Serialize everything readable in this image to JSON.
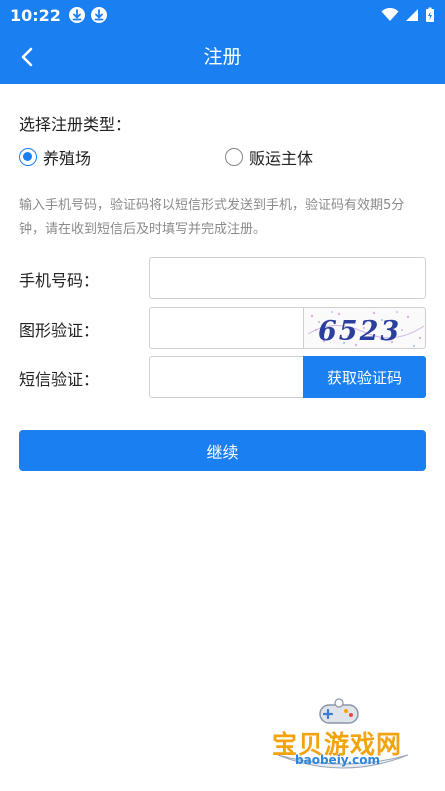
{
  "status_bar": {
    "time": "10:22",
    "icons": [
      "download-icon",
      "download-icon",
      "wifi-icon",
      "signal-icon",
      "battery-charging-icon"
    ]
  },
  "header": {
    "title": "注册",
    "back_icon": "chevron-left-icon",
    "color": "#1a7ff0"
  },
  "register_type": {
    "label": "选择注册类型：",
    "options": [
      {
        "label": "养殖场",
        "selected": true
      },
      {
        "label": "贩运主体",
        "selected": false
      }
    ]
  },
  "hint": "输入手机号码，验证码将以短信形式发送到手机，验证码有效期5分钟，请在收到短信后及时填写并完成注册。",
  "form": {
    "phone": {
      "label": "手机号码：",
      "value": "",
      "placeholder": ""
    },
    "captcha": {
      "label": "图形验证：",
      "value": "",
      "placeholder": "",
      "image_text": "6523"
    },
    "sms": {
      "label": "短信验证：",
      "value": "",
      "placeholder": "",
      "button_label": "获取验证码"
    }
  },
  "continue_label": "继续",
  "watermark": {
    "text": "宝贝游戏网",
    "url": "baobeiy.com"
  }
}
